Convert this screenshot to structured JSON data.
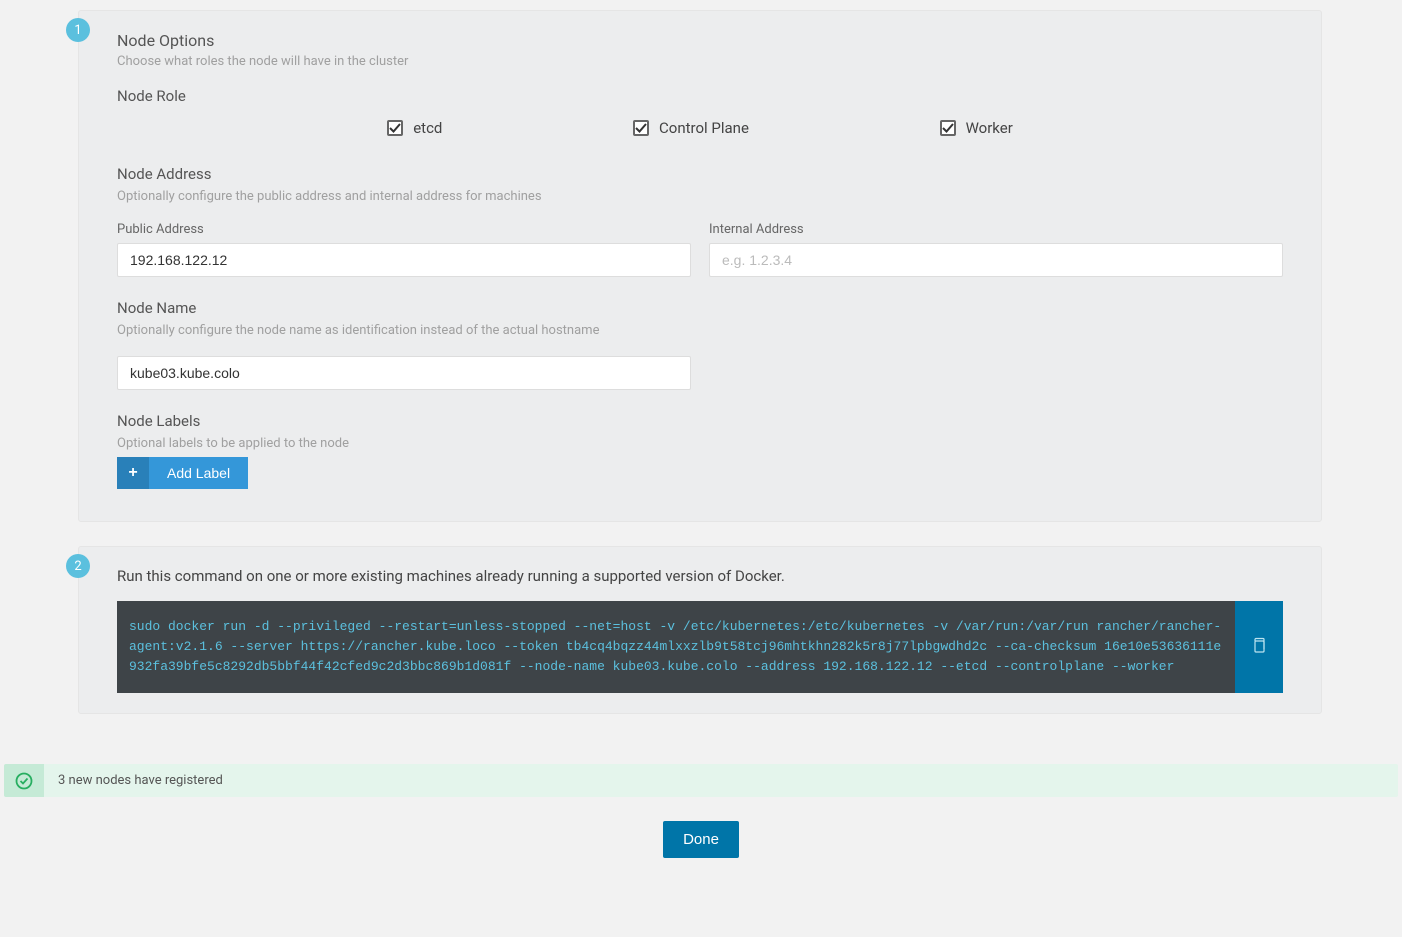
{
  "step1": {
    "badge": "1",
    "nodeOptions": {
      "title": "Node Options",
      "subtitle": "Choose what roles the node will have in the cluster"
    },
    "nodeRole": {
      "label": "Node Role",
      "etcd": "etcd",
      "controlPlane": "Control Plane",
      "worker": "Worker"
    },
    "nodeAddress": {
      "label": "Node Address",
      "subtitle": "Optionally configure the public address and internal address for machines",
      "publicLabel": "Public Address",
      "publicValue": "192.168.122.12",
      "internalLabel": "Internal Address",
      "internalPlaceholder": "e.g. 1.2.3.4"
    },
    "nodeName": {
      "label": "Node Name",
      "subtitle": "Optionally configure the node name as identification instead of the actual hostname",
      "value": "kube03.kube.colo"
    },
    "nodeLabels": {
      "label": "Node Labels",
      "subtitle": "Optional labels to be applied to the node",
      "addLabel": "Add Label"
    }
  },
  "step2": {
    "badge": "2",
    "description": "Run this command on one or more existing machines already running a supported version of Docker.",
    "command": "sudo docker run -d --privileged --restart=unless-stopped --net=host -v /etc/kubernetes:/etc/kubernetes -v /var/run:/var/run rancher/rancher-agent:v2.1.6 --server https://rancher.kube.loco --token tb4cq4bqzz44mlxxzlb9t58tcj96mhtkhn282k5r8j77lpbgwdhd2c --ca-checksum 16e10e53636111e932fa39bfe5c8292db5bbf44f42cfed9c2d3bbc869b1d081f --node-name kube03.kube.colo --address 192.168.122.12 --etcd --controlplane --worker"
  },
  "notification": {
    "text": "3 new nodes have registered"
  },
  "done": {
    "label": "Done"
  }
}
